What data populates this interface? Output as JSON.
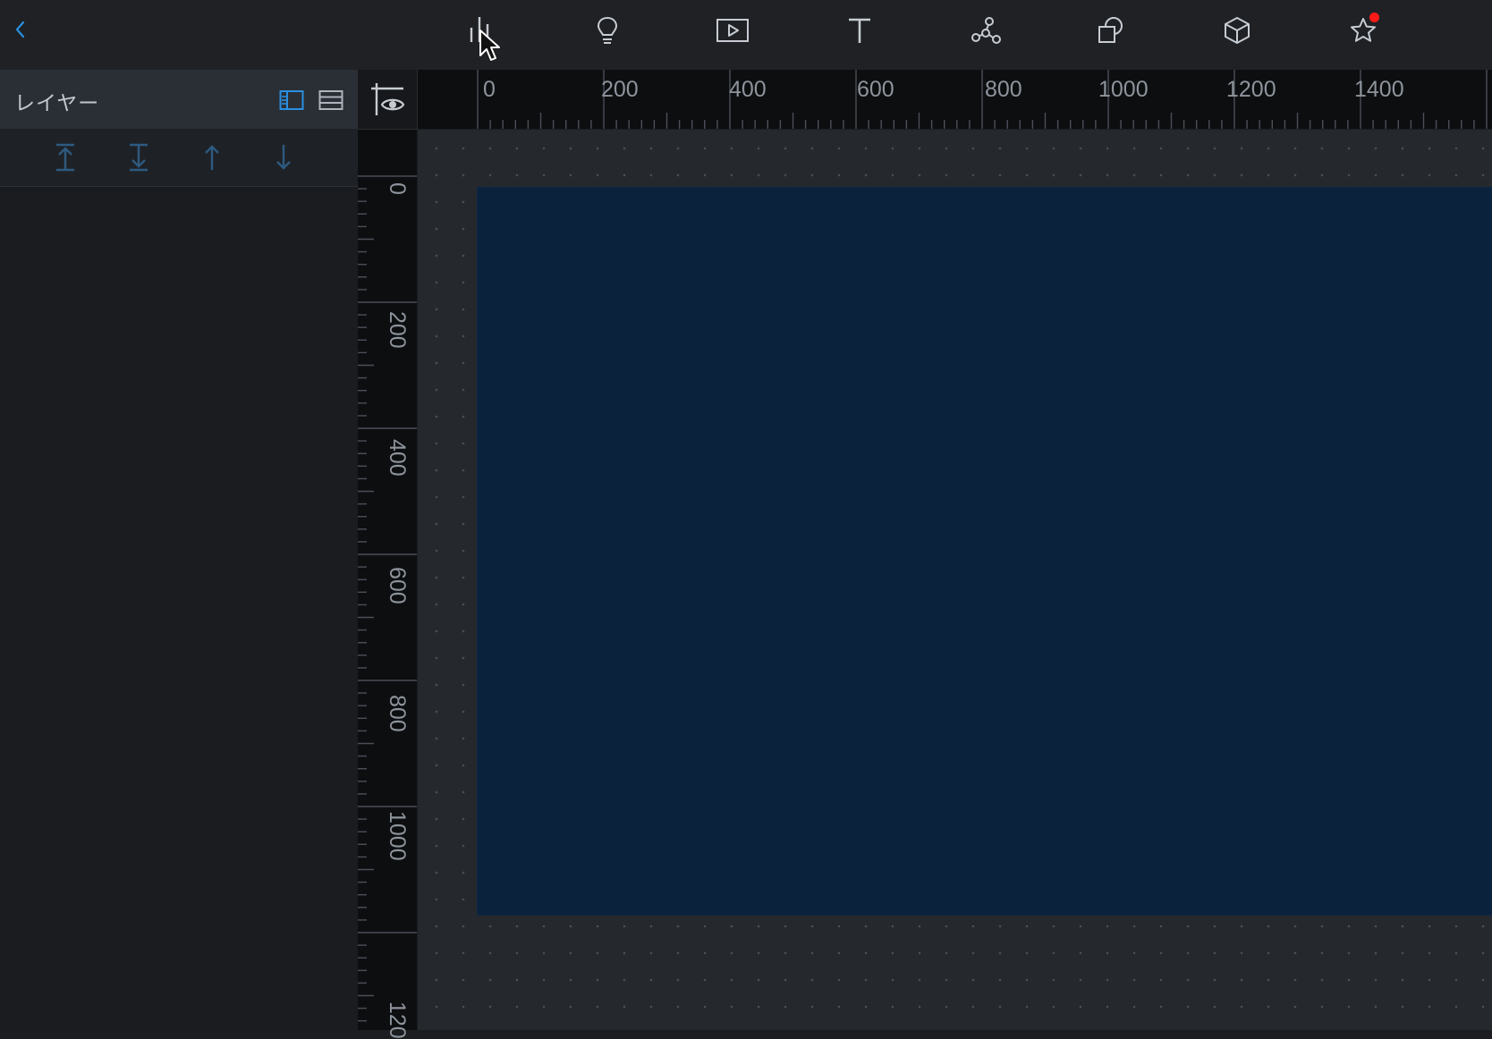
{
  "topbar": {
    "back_icon": "chevron-left-icon",
    "tools": [
      {
        "id": "chart",
        "icon": "bar-chart-icon"
      },
      {
        "id": "idea",
        "icon": "lightbulb-icon"
      },
      {
        "id": "media",
        "icon": "play-video-icon"
      },
      {
        "id": "text",
        "icon": "text-icon"
      },
      {
        "id": "network",
        "icon": "network-graph-icon"
      },
      {
        "id": "shapes",
        "icon": "shapes-icon"
      },
      {
        "id": "3d",
        "icon": "cube-icon"
      },
      {
        "id": "favorites",
        "icon": "star-icon",
        "has_notification": true
      }
    ]
  },
  "layer_panel": {
    "title": "レイヤー",
    "view_modes": [
      "layer-detail-view-icon",
      "layer-list-view-icon"
    ],
    "active_view": "layer-detail-view-icon",
    "order_actions": [
      "bring-to-front-icon",
      "send-to-back-icon",
      "bring-forward-icon",
      "send-backward-icon"
    ]
  },
  "rulers": {
    "horizontal_labels": [
      "0",
      "200",
      "400",
      "600",
      "800",
      "1000",
      "1200",
      "1400"
    ],
    "vertical_labels": [
      "0",
      "200",
      "400",
      "600",
      "800",
      "1000",
      "120"
    ]
  },
  "colors": {
    "accent": "#2a8fe0",
    "artboard": "#0b223d",
    "workspace": "#25282c",
    "notification": "#ff1a1a"
  }
}
